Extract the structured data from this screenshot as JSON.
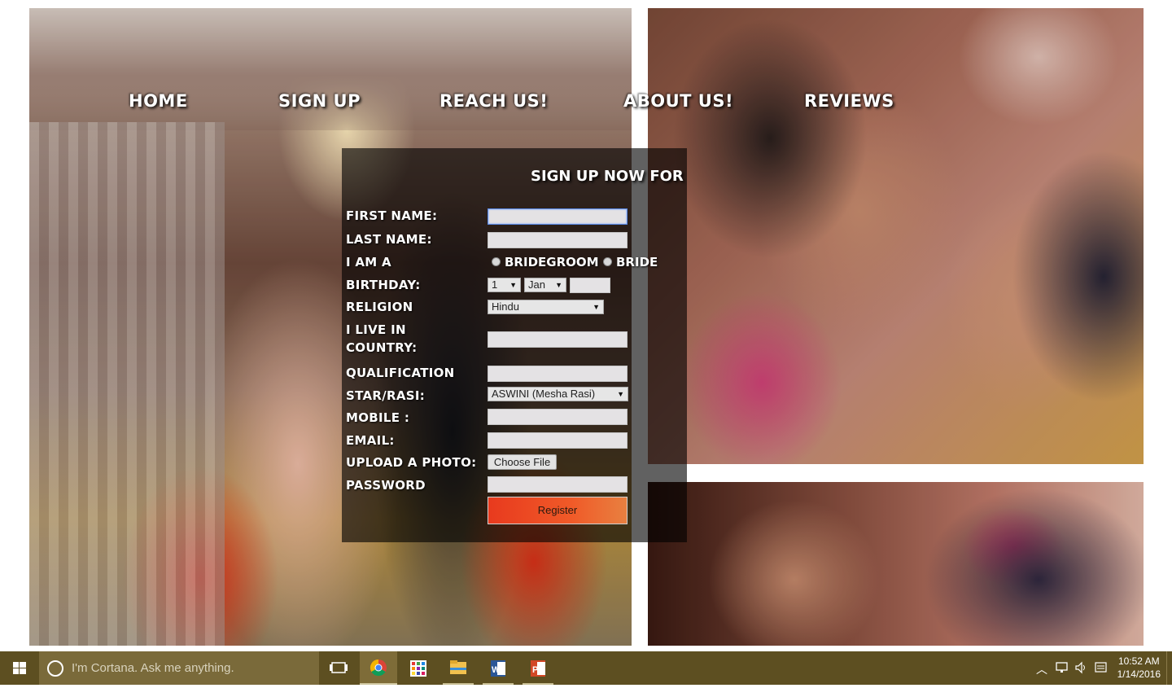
{
  "nav": {
    "home": "HOME",
    "signup": "SIGN UP",
    "reach": "REACH US!",
    "about": "ABOUT US!",
    "reviews": "REVIEWS"
  },
  "form": {
    "title": "SIGN UP NOW FOR F",
    "labels": {
      "first_name": "FIRST NAME:",
      "last_name": "LAST NAME:",
      "i_am_a": "I AM A",
      "birthday": "BIRTHDAY:",
      "religion": "RELIGION",
      "country_line1": "I LIVE IN",
      "country_line2": "COUNTRY:",
      "qualification": "QUALIFICATION",
      "star": "STAR/RASI:",
      "mobile": "MOBILE :",
      "email": "EMAIL:",
      "photo": "UPLOAD A PHOTO:",
      "password": "PASSWORD"
    },
    "values": {
      "first_name": "",
      "last_name": "",
      "birth_year": "",
      "country": "",
      "qualification": "",
      "mobile": "",
      "email": "",
      "password": ""
    },
    "gender_options": [
      "BRIDEGROOM",
      "BRIDE"
    ],
    "birth_day": "1",
    "birth_month": "Jan",
    "religion": "Hindu",
    "star": "ASWINI (Mesha Rasi)",
    "choose_file": "Choose File",
    "register": "Register"
  },
  "taskbar": {
    "cortana_placeholder": "I'm Cortana. Ask me anything.",
    "time": "10:52 AM",
    "date": "1/14/2016",
    "apps": [
      "task-view-icon",
      "chrome-icon",
      "store-icon",
      "file-explorer-icon",
      "word-icon",
      "powerpoint-icon"
    ]
  }
}
